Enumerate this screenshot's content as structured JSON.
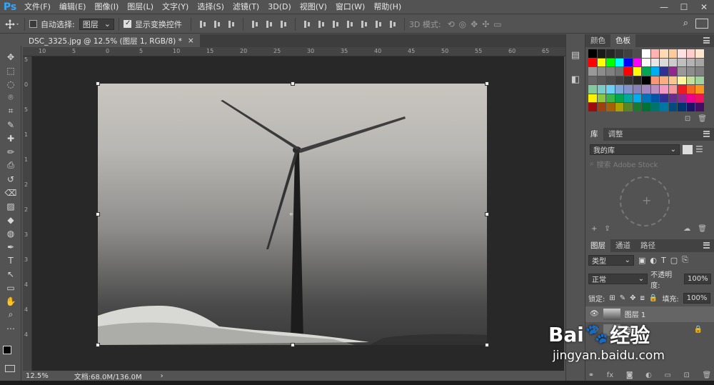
{
  "app": {
    "logo": "Ps"
  },
  "menu": [
    "文件(F)",
    "编辑(E)",
    "图像(I)",
    "图层(L)",
    "文字(Y)",
    "选择(S)",
    "滤镜(T)",
    "3D(D)",
    "视图(V)",
    "窗口(W)",
    "帮助(H)"
  ],
  "window_controls": [
    "—",
    "☐",
    "✕"
  ],
  "options": {
    "auto_select_label": "自动选择:",
    "auto_select_value": "图层",
    "show_transform_label": "显示变换控件",
    "mode3d_label": "3D 模式:"
  },
  "document": {
    "tab_title": "DSC_3325.jpg @ 12.5% (图层 1, RGB/8) *",
    "tab_close": "×"
  },
  "ruler_h": [
    "10",
    "5",
    "0",
    "5",
    "10",
    "15",
    "20",
    "25",
    "30",
    "35",
    "40",
    "45",
    "50",
    "55",
    "60",
    "65"
  ],
  "ruler_v": [
    "5",
    "0",
    "5",
    "1",
    "1",
    "2",
    "2",
    "3",
    "3",
    "4",
    "4",
    "4"
  ],
  "status": {
    "zoom": "12.5%",
    "doc_info": "文档:68.0M/136.0M",
    "arrow": "›"
  },
  "panels": {
    "color_tabs": [
      "颜色",
      "色板"
    ],
    "library_tabs": [
      "库",
      "调整"
    ],
    "library_select": "我的库",
    "library_search": "搜索 Adobe Stock",
    "layer_tabs": [
      "图层",
      "通道",
      "路径"
    ],
    "layer_filter": "类型",
    "blend_mode": "正常",
    "opacity_label": "不透明度:",
    "opacity_value": "100%",
    "lock_label": "锁定:",
    "fill_label": "填充:",
    "fill_value": "100%",
    "layers": [
      {
        "name": "图层 1"
      },
      {
        "name": "背景"
      }
    ]
  },
  "swatch_colors": [
    "#000000",
    "#1a1a1a",
    "#262626",
    "#333333",
    "#404040",
    "#4d4d4d",
    "#ffffff",
    "#ffb3b3",
    "#ffd9b3",
    "#ffcc99",
    "#ffe0e0",
    "#ffcccc",
    "#ffe5cc",
    "#ff0000",
    "#ffff00",
    "#00ff00",
    "#00ffff",
    "#0000ff",
    "#ff00ff",
    "#ffffff",
    "#e6e6e6",
    "#d9d9d9",
    "#cccccc",
    "#bfbfbf",
    "#b3b3b3",
    "#a6a6a6",
    "#999999",
    "#8c8c8c",
    "#808080",
    "#737373",
    "#ff0000",
    "#ffff00",
    "#00a651",
    "#00aeef",
    "#2e3192",
    "#92278f",
    "#999999",
    "#8c8c8c",
    "#808080",
    "#666666",
    "#595959",
    "#4d4d4d",
    "#404040",
    "#333333",
    "#262626",
    "#000000",
    "#f7977a",
    "#f9ad81",
    "#fdc68a",
    "#fff79a",
    "#c4df9b",
    "#a3d39c",
    "#82ca9c",
    "#7accc8",
    "#6dcff6",
    "#7da7d9",
    "#8393ca",
    "#8781bd",
    "#a187be",
    "#bc8dbf",
    "#f49ac2",
    "#f6989d",
    "#ed1c24",
    "#f26522",
    "#f7941d",
    "#fff200",
    "#8dc73f",
    "#39b54a",
    "#00a651",
    "#00a99d",
    "#00aeef",
    "#0072bc",
    "#0054a6",
    "#2e3192",
    "#662d91",
    "#92278f",
    "#ec008c",
    "#ed145b",
    "#9e0b0f",
    "#a0410d",
    "#a36209",
    "#aba000",
    "#598527",
    "#1a7b30",
    "#007236",
    "#00746b",
    "#0076a3",
    "#004b80",
    "#003471",
    "#1b1464",
    "#440e62"
  ],
  "toolbar_tools": [
    "move-tool",
    "marquee-tool",
    "lasso-tool",
    "quick-select-tool",
    "crop-tool",
    "eyedropper-tool",
    "healing-tool",
    "brush-tool",
    "stamp-tool",
    "history-brush-tool",
    "eraser-tool",
    "gradient-tool",
    "blur-tool",
    "dodge-tool",
    "pen-tool",
    "type-tool",
    "path-select-tool",
    "shape-tool",
    "hand-tool",
    "zoom-tool",
    "more-tools"
  ],
  "type_tool_label": "T",
  "watermark": {
    "brand": "Bai",
    "brand2": "经验",
    "url": "jingyan.baidu.com"
  }
}
